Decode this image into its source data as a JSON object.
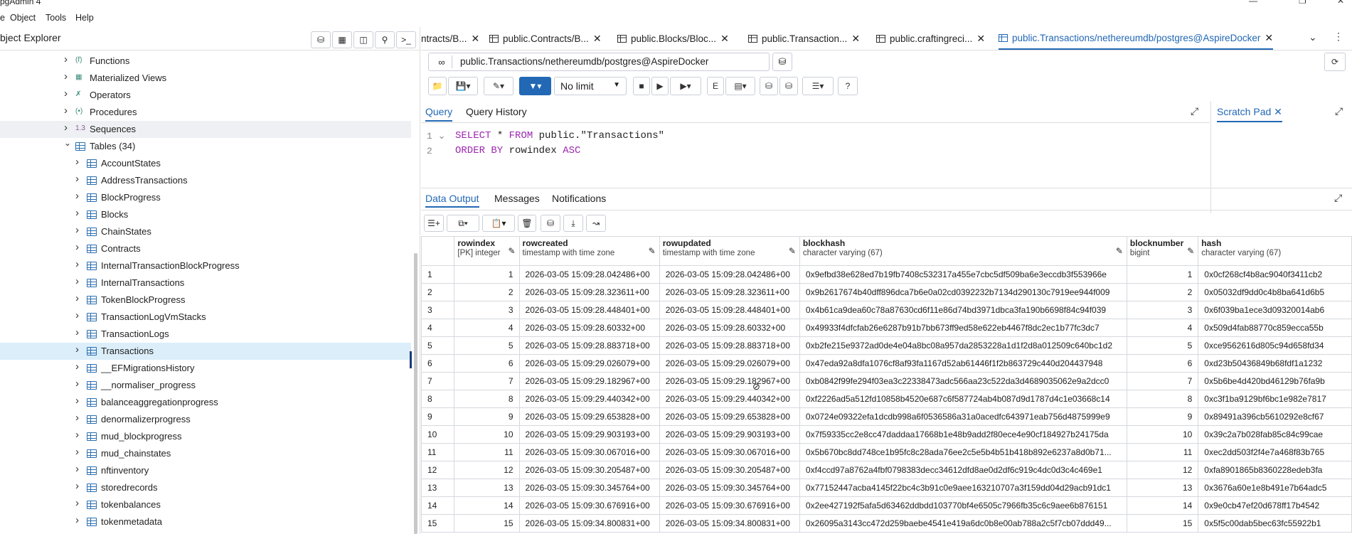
{
  "app": {
    "title": "pgAdmin 4",
    "menu": [
      "e",
      "Object",
      "Tools",
      "Help"
    ]
  },
  "object_explorer": {
    "title": "bject Explorer",
    "tree": [
      {
        "label": "Functions",
        "icon": "function-icon",
        "level": 1
      },
      {
        "label": "Materialized Views",
        "icon": "matview-icon",
        "level": 1
      },
      {
        "label": "Operators",
        "icon": "operator-icon",
        "level": 1
      },
      {
        "label": "Procedures",
        "icon": "procedure-icon",
        "level": 1
      },
      {
        "label": "Sequences",
        "icon": "sequence-icon",
        "level": 1,
        "highlight": true
      },
      {
        "label": "Tables (34)",
        "icon": "tables-icon",
        "level": 1,
        "expanded": true
      },
      {
        "label": "AccountStates",
        "level": 2
      },
      {
        "label": "AddressTransactions",
        "level": 2
      },
      {
        "label": "BlockProgress",
        "level": 2
      },
      {
        "label": "Blocks",
        "level": 2
      },
      {
        "label": "ChainStates",
        "level": 2
      },
      {
        "label": "Contracts",
        "level": 2
      },
      {
        "label": "InternalTransactionBlockProgress",
        "level": 2
      },
      {
        "label": "InternalTransactions",
        "level": 2
      },
      {
        "label": "TokenBlockProgress",
        "level": 2
      },
      {
        "label": "TransactionLogVmStacks",
        "level": 2
      },
      {
        "label": "TransactionLogs",
        "level": 2
      },
      {
        "label": "Transactions",
        "level": 2,
        "selected": true
      },
      {
        "label": "__EFMigrationsHistory",
        "level": 2
      },
      {
        "label": "__normaliser_progress",
        "level": 2
      },
      {
        "label": "balanceaggregationprogress",
        "level": 2
      },
      {
        "label": "denormalizerprogress",
        "level": 2
      },
      {
        "label": "mud_blockprogress",
        "level": 2
      },
      {
        "label": "mud_chainstates",
        "level": 2
      },
      {
        "label": "nftinventory",
        "level": 2
      },
      {
        "label": "storedrecords",
        "level": 2
      },
      {
        "label": "tokenbalances",
        "level": 2
      },
      {
        "label": "tokenmetadata",
        "level": 2
      }
    ]
  },
  "tabs": [
    {
      "label": "ntracts/B...",
      "active": false
    },
    {
      "label": "public.Contracts/B...",
      "active": false
    },
    {
      "label": "public.Blocks/Bloc...",
      "active": false
    },
    {
      "label": "public.Transaction...",
      "active": false
    },
    {
      "label": "public.craftingreci...",
      "active": false
    },
    {
      "label": "public.Transactions/nethereumdb/postgres@AspireDocker",
      "active": true
    }
  ],
  "connection": "public.Transactions/nethereumdb/postgres@AspireDocker",
  "limit": "No limit",
  "query_tabs": [
    "Query",
    "Query History"
  ],
  "scratch_pad": "Scratch Pad",
  "editor": {
    "line1_kw1": "SELECT",
    "line1_rest": " * ",
    "line1_kw2": "FROM",
    "line1_tail": " public.\"Transactions\"",
    "line2_kw1": "ORDER BY",
    "line2_mid": " rowindex ",
    "line2_kw2": "ASC"
  },
  "output_tabs": [
    "Data Output",
    "Messages",
    "Notifications"
  ],
  "grid": {
    "columns": [
      {
        "name": "rowindex",
        "type": "[PK] integer"
      },
      {
        "name": "rowcreated",
        "type": "timestamp with time zone"
      },
      {
        "name": "rowupdated",
        "type": "timestamp with time zone"
      },
      {
        "name": "blockhash",
        "type": "character varying (67)"
      },
      {
        "name": "blocknumber",
        "type": "bigint"
      },
      {
        "name": "hash",
        "type": "character varying (67)"
      }
    ],
    "rows": [
      [
        "1",
        "1",
        "2026-03-05 15:09:28.042486+00",
        "2026-03-05 15:09:28.042486+00",
        "0x9efbd38e628ed7b19fb7408c532317a455e7cbc5df509ba6e3eccdb3f553966e",
        "1",
        "0x0cf268cf4b8ac9040f3411cb2"
      ],
      [
        "2",
        "2",
        "2026-03-05 15:09:28.323611+00",
        "2026-03-05 15:09:28.323611+00",
        "0x9b2617674b40dff896dca7b6e0a02cd0392232b7134d290130c7919ee944f009",
        "2",
        "0x05032df9dd0c4b8ba641d6b5"
      ],
      [
        "3",
        "3",
        "2026-03-05 15:09:28.448401+00",
        "2026-03-05 15:09:28.448401+00",
        "0x4b61ca9dea60c78a87630cd6f11e86d74bd3971dbca3fa190b6698f84c94f039",
        "3",
        "0x6f039ba1ece3d09320014ab6"
      ],
      [
        "4",
        "4",
        "2026-03-05 15:09:28.60332+00",
        "2026-03-05 15:09:28.60332+00",
        "0x49933f4dfcfab26e6287b91b7bb673ff9ed58e622eb4467f8dc2ec1b77fc3dc7",
        "4",
        "0x509d4fab88770c859ecca55b"
      ],
      [
        "5",
        "5",
        "2026-03-05 15:09:28.883718+00",
        "2026-03-05 15:09:28.883718+00",
        "0xb2fe215e9372ad0de4e04a8bc08a957da2853228a1d1f2d8a012509c640bc1d2",
        "5",
        "0xce9562616d805c94d658fd34"
      ],
      [
        "6",
        "6",
        "2026-03-05 15:09:29.026079+00",
        "2026-03-05 15:09:29.026079+00",
        "0x47eda92a8dfa1076cf8af93fa1167d52ab61446f1f2b863729c440d204437948",
        "6",
        "0xd23b50436849b68fdf1a1232"
      ],
      [
        "7",
        "7",
        "2026-03-05 15:09:29.182967+00",
        "2026-03-05 15:09:29.182967+00",
        "0xb0842f99fe294f03ea3c22338473adc566aa23c522da3d4689035062e9a2dcc0",
        "7",
        "0x5b6be4d420bd46129b76fa9b"
      ],
      [
        "8",
        "8",
        "2026-03-05 15:09:29.440342+00",
        "2026-03-05 15:09:29.440342+00",
        "0xf2226ad5a512fd10858b4520e687c6f587724ab4b087d9d1787d4c1e03668c14",
        "8",
        "0xc3f1ba9129bf6bc1e982e7817"
      ],
      [
        "9",
        "9",
        "2026-03-05 15:09:29.653828+00",
        "2026-03-05 15:09:29.653828+00",
        "0x0724e09322efa1dcdb998a6f0536586a31a0acedfc643971eab756d4875999e9",
        "9",
        "0x89491a396cb5610292e8cf67"
      ],
      [
        "10",
        "10",
        "2026-03-05 15:09:29.903193+00",
        "2026-03-05 15:09:29.903193+00",
        "0x7f59335cc2e8cc47daddaa17668b1e48b9add2f80ece4e90cf184927b24175da",
        "10",
        "0x39c2a7b028fab85c84c99cae"
      ],
      [
        "11",
        "11",
        "2026-03-05 15:09:30.067016+00",
        "2026-03-05 15:09:30.067016+00",
        "0x5b670bc8dd748ce1b95fc8c28ada76ee2c5e5b4b51b418b892e6237a8d0b71...",
        "11",
        "0xec2dd503f2f4e7a468f83b765"
      ],
      [
        "12",
        "12",
        "2026-03-05 15:09:30.205487+00",
        "2026-03-05 15:09:30.205487+00",
        "0xf4ccd97a8762a4fbf0798383decc34612dfd8ae0d2df6c919c4dc0d3c4c469e1",
        "12",
        "0xfa8901865b8360228edeb3fa"
      ],
      [
        "13",
        "13",
        "2026-03-05 15:09:30.345764+00",
        "2026-03-05 15:09:30.345764+00",
        "0x77152447acba4145f22bc4c3b91c0e9aee163210707a3f159dd04d29acb91dc1",
        "13",
        "0x3676a60e1e8b491e7b64adc5"
      ],
      [
        "14",
        "14",
        "2026-03-05 15:09:30.676916+00",
        "2026-03-05 15:09:30.676916+00",
        "0x2ee427192f5afa5d63462ddbdd103770bf4e6505c7966fb35c6c9aee6b876151",
        "14",
        "0x9e0cb47ef20d678ff17b4542"
      ],
      [
        "15",
        "15",
        "2026-03-05 15:09:34.800831+00",
        "2026-03-05 15:09:34.800831+00",
        "0x26095a3143cc472d259baebe4541e419a6dc0b8e00ab788a2c5f7cb07ddd49...",
        "15",
        "0x5f5c00dab5bec63fc55922b1"
      ]
    ]
  }
}
